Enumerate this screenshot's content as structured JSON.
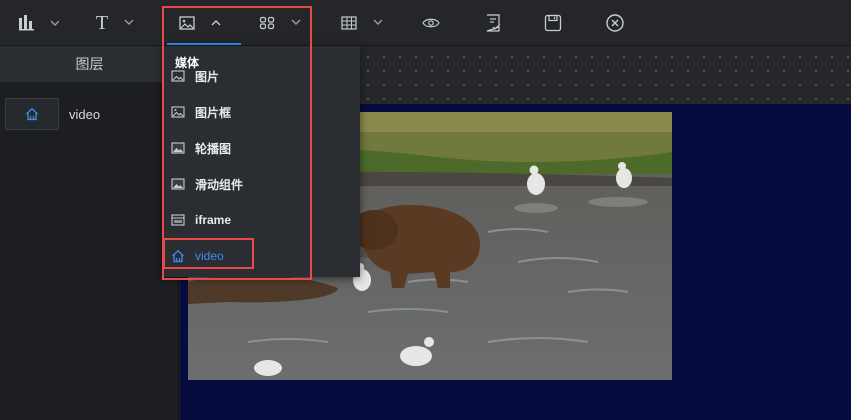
{
  "toolbar": {
    "items": [
      {
        "name": "chart",
        "icon": "bar-chart-icon",
        "has_dropdown": true
      },
      {
        "name": "text",
        "label": "T",
        "icon": "text-icon",
        "has_dropdown": true
      },
      {
        "name": "media",
        "icon": "image-icon",
        "has_dropdown": true,
        "active": true
      },
      {
        "name": "components",
        "icon": "grid-icon",
        "has_dropdown": true
      },
      {
        "name": "table",
        "icon": "table-icon",
        "has_dropdown": true
      },
      {
        "name": "preview",
        "icon": "eye-icon"
      },
      {
        "name": "checklist",
        "icon": "checklist-icon"
      },
      {
        "name": "save",
        "icon": "save-icon"
      },
      {
        "name": "close",
        "icon": "close-circle-icon"
      }
    ],
    "text_label": "T"
  },
  "left_panel": {
    "header": "图层",
    "layers": [
      {
        "label": "video",
        "icon": "home-icon"
      }
    ]
  },
  "dropdown": {
    "group_label": "媒体",
    "items": [
      {
        "label": "图片",
        "icon": "image-icon"
      },
      {
        "label": "图片框",
        "icon": "image-frame-icon"
      },
      {
        "label": "轮播图",
        "icon": "carousel-icon"
      },
      {
        "label": "滑动组件",
        "icon": "slider-icon"
      },
      {
        "label": "iframe",
        "icon": "iframe-icon"
      },
      {
        "label": "video",
        "icon": "home-icon",
        "selected": true
      }
    ]
  },
  "colors": {
    "accent": "#2f8cf0",
    "highlight": "#e84a4a",
    "stage_bg": "#060c3e"
  }
}
